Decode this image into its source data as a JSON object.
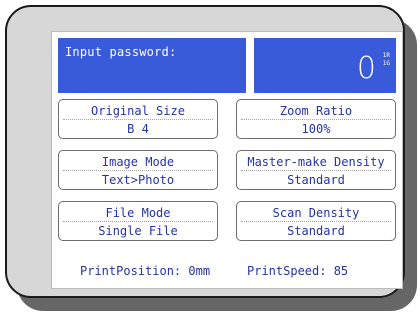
{
  "header": {
    "password_label": "Input password:",
    "copy_count": "0",
    "tray_top": "1R",
    "tray_bottom": "1G"
  },
  "buttons": [
    {
      "label": "Original Size",
      "value": "B 4"
    },
    {
      "label": "Zoom Ratio",
      "value": "100%"
    },
    {
      "label": "Image Mode",
      "value": "Text>Photo"
    },
    {
      "label": "Master-make Density",
      "value": "Standard"
    },
    {
      "label": "File Mode",
      "value": "Single File"
    },
    {
      "label": "Scan Density",
      "value": "Standard"
    }
  ],
  "footer": {
    "print_position": "PrintPosition: 0mm",
    "print_speed": "PrintSpeed: 85"
  },
  "colors": {
    "accent_blue": "#3a5bd9",
    "text_blue": "#2534a6"
  }
}
